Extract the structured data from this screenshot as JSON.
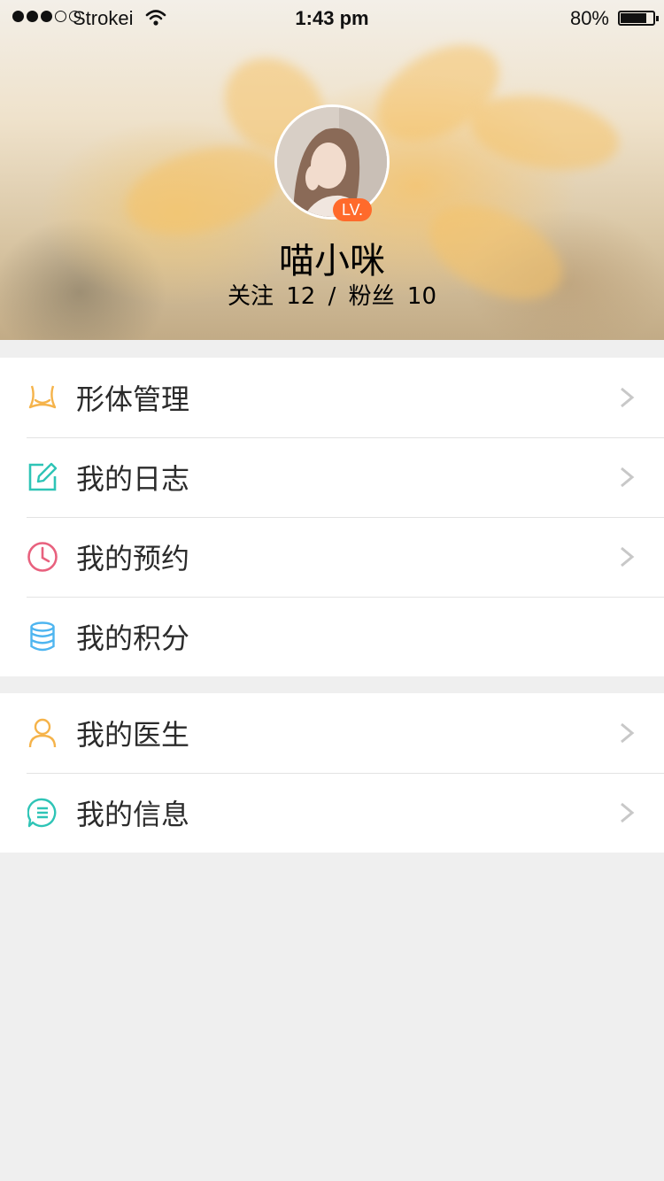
{
  "status_bar": {
    "carrier": "Strokei",
    "time": "1:43 pm",
    "battery_percent": "80%",
    "battery_level": 0.8,
    "signal_bars": 3
  },
  "profile": {
    "username": "喵小咪",
    "level_badge": "LV.",
    "follow_stats": "关注 12 / 粉丝 10",
    "badge_color": "#FF6A2B"
  },
  "menu_groups": [
    [
      {
        "label": "形体管理",
        "icon": "body-shape-icon",
        "icon_color": "#F5B34A"
      },
      {
        "label": "我的日志",
        "icon": "edit-journal-icon",
        "icon_color": "#2EC4B6"
      },
      {
        "label": "我的预约",
        "icon": "clock-icon",
        "icon_color": "#E8617E"
      },
      {
        "label": "我的积分",
        "icon": "database-coins-icon",
        "icon_color": "#4EB5F0"
      }
    ],
    [
      {
        "label": "我的医生",
        "icon": "user-icon",
        "icon_color": "#F5B34A"
      },
      {
        "label": "我的信息",
        "icon": "message-list-icon",
        "icon_color": "#2EC4B6"
      }
    ]
  ],
  "arrow_icon": "chevron-right-icon",
  "colors": {
    "page_background": "#EFEFEF",
    "label_text": "#2B2B2B",
    "arrow": "#C8C8C8"
  }
}
